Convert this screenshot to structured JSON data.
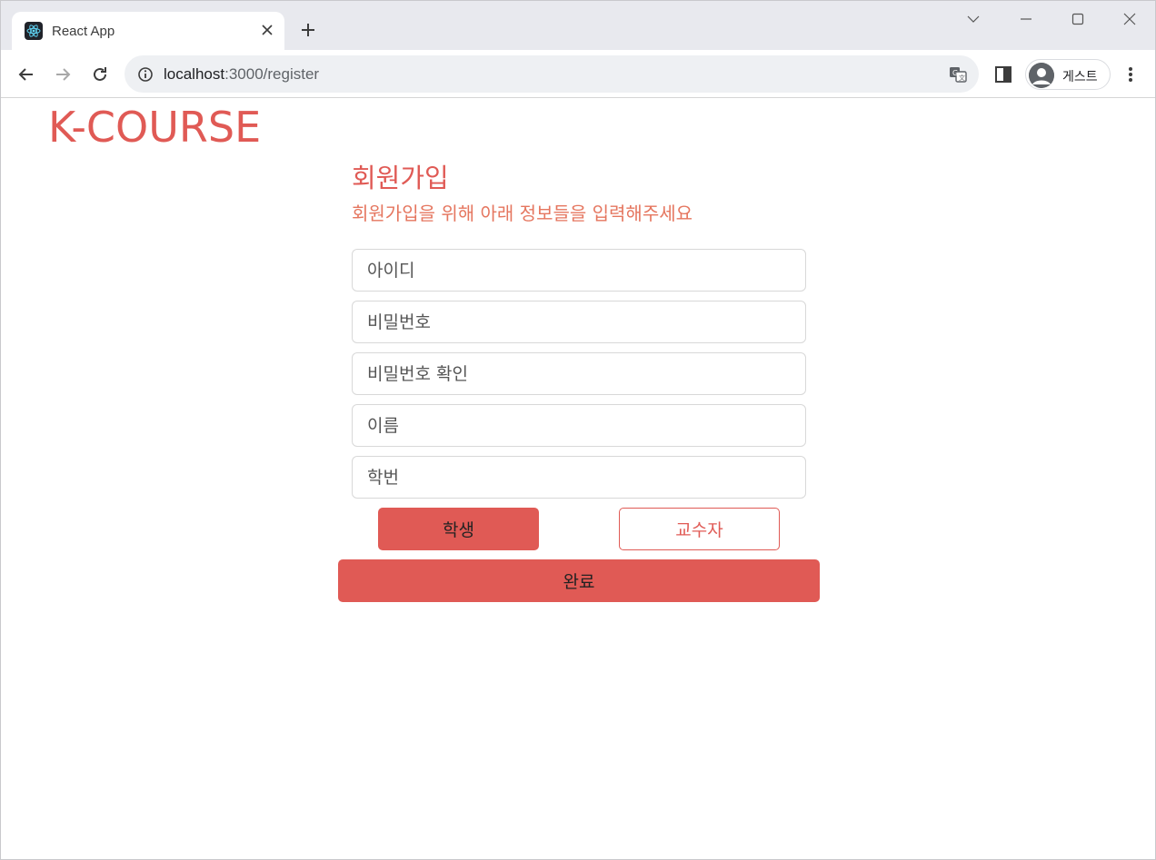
{
  "browser": {
    "tab": {
      "title": "React App"
    },
    "url": {
      "host": "localhost",
      "rest": ":3000/register"
    },
    "profile": {
      "label": "게스트"
    }
  },
  "page": {
    "logo": "K-COURSE",
    "title": "회원가입",
    "subtitle": "회원가입을 위해 아래 정보들을 입력해주세요",
    "fields": [
      {
        "placeholder": "아이디"
      },
      {
        "placeholder": "비밀번호"
      },
      {
        "placeholder": "비밀번호 확인"
      },
      {
        "placeholder": "이름"
      },
      {
        "placeholder": "학번"
      }
    ],
    "roles": {
      "student": "학생",
      "professor": "교수자"
    },
    "submit": "완료"
  },
  "colors": {
    "accent": "#e05a55",
    "subtitle": "#e5765f"
  }
}
